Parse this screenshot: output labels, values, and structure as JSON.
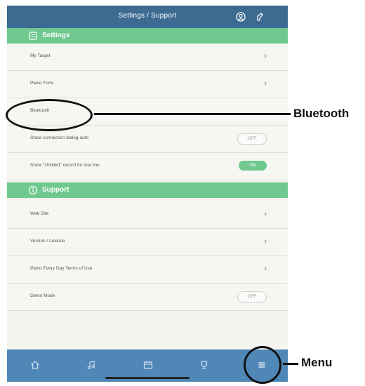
{
  "topbar": {
    "title": "Settings / Support",
    "icons": [
      "profile-icon",
      "tuner-icon"
    ]
  },
  "settings_section": {
    "label": "Settings",
    "icon": "gear-icon",
    "rows": [
      {
        "label": "My Target",
        "control": "chevron"
      },
      {
        "label": "Piano Form",
        "control": "chevron"
      },
      {
        "label": "Bluetooth",
        "control": "none"
      },
      {
        "label": "Show connection dialog auto",
        "control": "toggle",
        "state": "OFF"
      },
      {
        "label": "Show \"Untitled\" record for one line",
        "control": "toggle",
        "state": "ON"
      }
    ]
  },
  "support_section": {
    "label": "Support",
    "icon": "info-icon",
    "rows": [
      {
        "label": "Web Site",
        "control": "chevron"
      },
      {
        "label": "Version / Licence",
        "control": "chevron"
      },
      {
        "label": "Piano Every Day Terms of Use",
        "control": "chevron"
      },
      {
        "label": "Demo Mode",
        "control": "toggle",
        "state": "OFF"
      }
    ]
  },
  "bottombar": {
    "items": [
      "home-icon",
      "music-note-icon",
      "calendar-icon",
      "trophy-icon",
      "menu-icon"
    ]
  },
  "annotations": {
    "bluetooth": "Bluetooth",
    "menu": "Menu"
  },
  "colors": {
    "topbar": "#3d6a91",
    "section_header": "#6fc98e",
    "bottombar": "#4f87b7",
    "toggle_on": "#6fc98e"
  }
}
